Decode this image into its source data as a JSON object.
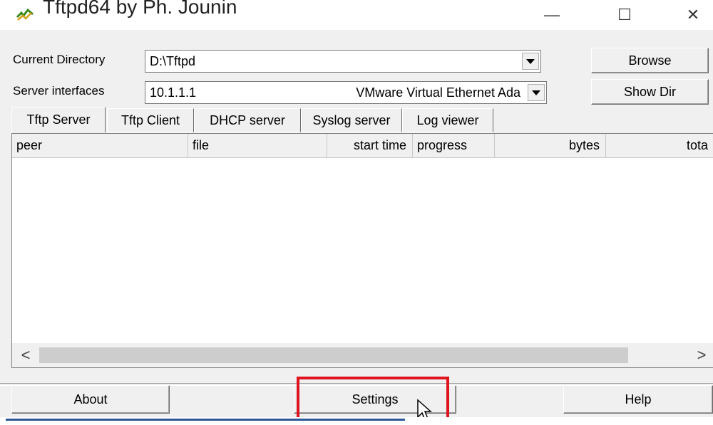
{
  "window": {
    "title": "Tftpd64 by Ph. Jounin",
    "controls": {
      "minimize": "—",
      "maximize": "☐",
      "close": "✕"
    },
    "icon": "tftpd-app-icon"
  },
  "current_directory": {
    "label": "Current Directory",
    "value": "D:\\Tftpd",
    "browse_label": "Browse"
  },
  "server_interfaces": {
    "label": "Server interfaces",
    "ip": "10.1.1.1",
    "adapter": "VMware Virtual Ethernet Ada",
    "show_dir_label": "Show Dir"
  },
  "tabs": [
    {
      "label": "Tftp Server",
      "active": true
    },
    {
      "label": "Tftp Client",
      "active": false
    },
    {
      "label": "DHCP server",
      "active": false
    },
    {
      "label": "Syslog server",
      "active": false
    },
    {
      "label": "Log viewer",
      "active": false
    }
  ],
  "table": {
    "columns": [
      "peer",
      "file",
      "start time",
      "progress",
      "bytes",
      "tota"
    ],
    "rows": []
  },
  "scrollbar": {
    "left_arrow": "<",
    "right_arrow": ">"
  },
  "footer": {
    "about_label": "About",
    "settings_label": "Settings",
    "help_label": "Help"
  },
  "colors": {
    "highlight": "#e0141e",
    "window_bg": "#f0f0f0"
  }
}
